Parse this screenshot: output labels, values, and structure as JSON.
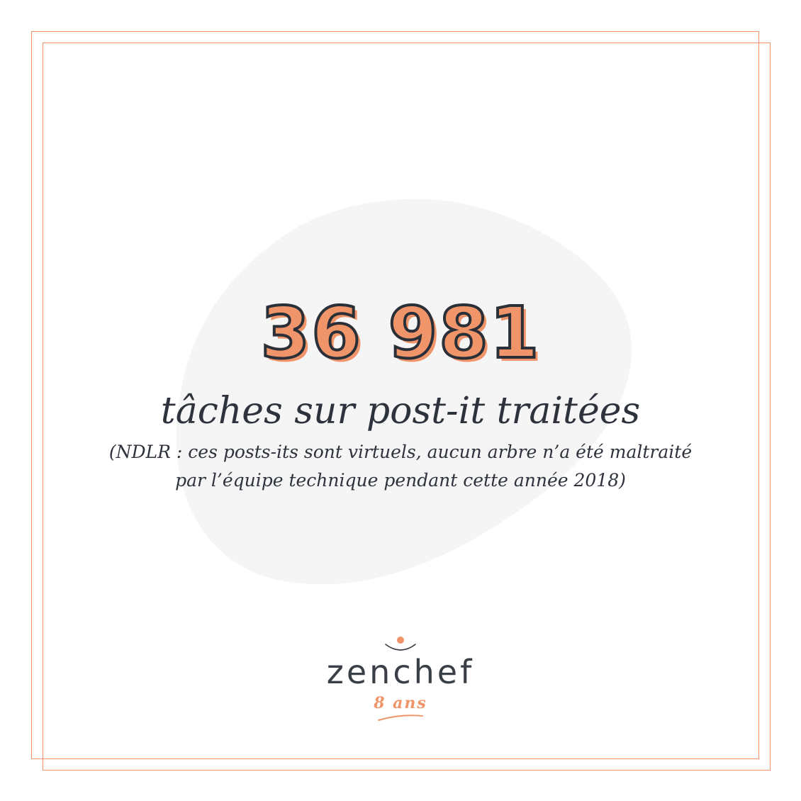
{
  "colors": {
    "accent": "#f0956a",
    "text": "#2d323c",
    "blob": "#f5f5f5",
    "background": "#ffffff"
  },
  "stat": {
    "number": "36 981",
    "label": "tâches sur post-it traitées",
    "note_line1": "(NDLR : ces posts-its sont virtuels, aucun arbre n’a été maltraité",
    "note_line2": "par l’équipe technique pendant cette année 2018)"
  },
  "logo": {
    "icon": "zenchef-smile-icon",
    "wordmark": "zenchef",
    "tagline": "8 ans"
  }
}
